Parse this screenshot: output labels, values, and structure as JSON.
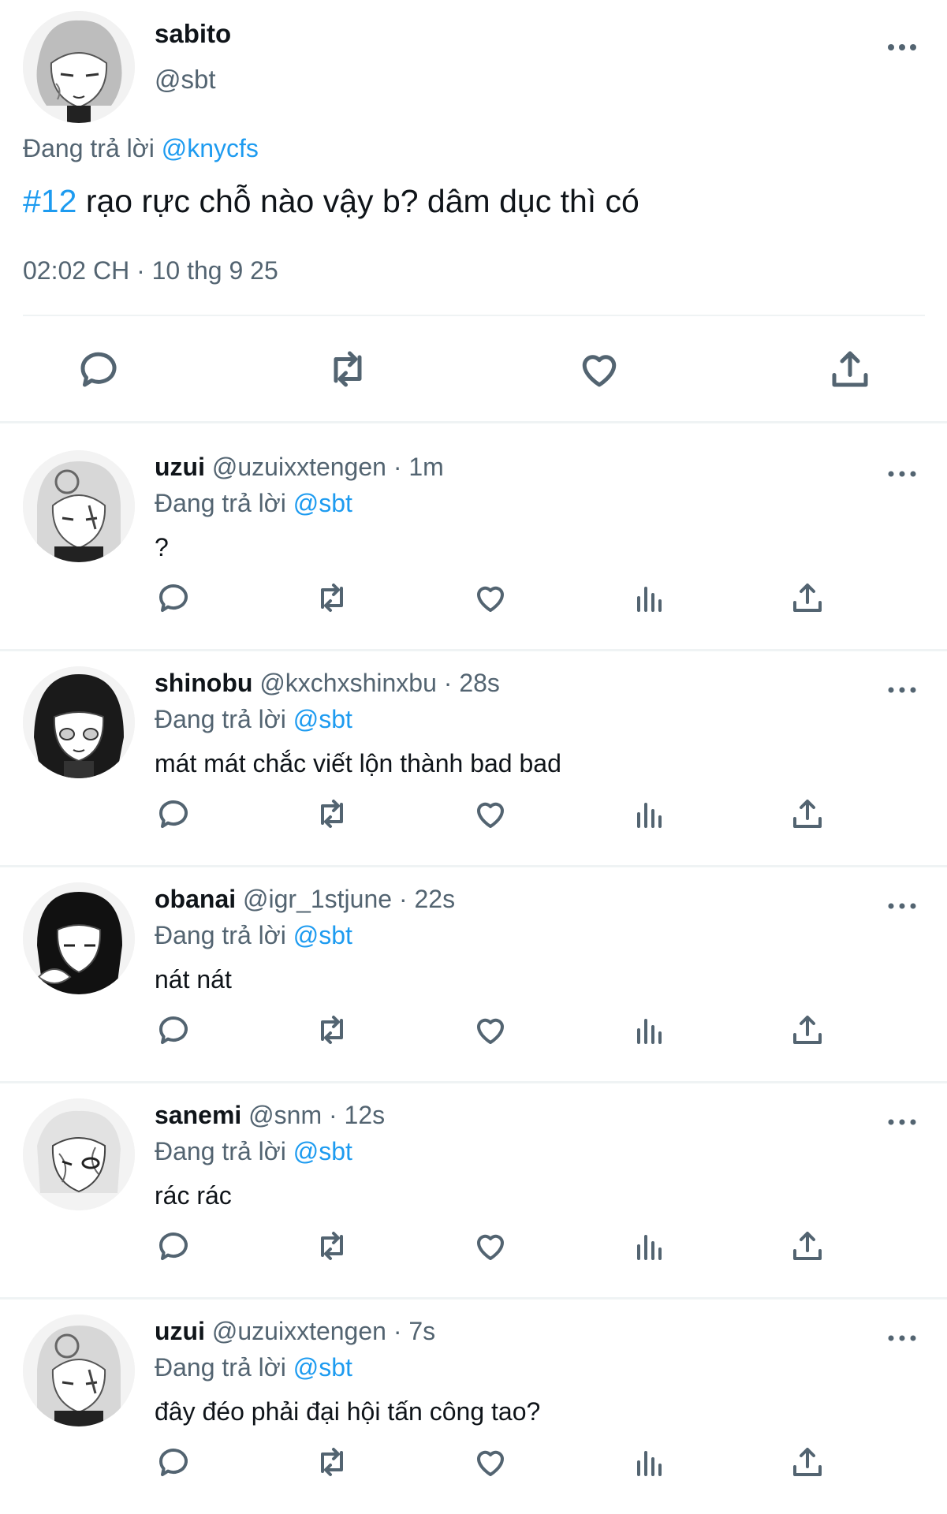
{
  "main_tweet": {
    "display_name": "sabito",
    "handle": "@sbt",
    "replying_label": "Đang trả lời",
    "replying_to": "@knycfs",
    "hashtag": "#12",
    "text": " rạo rực chỗ nào vậy b? dâm dục thì có",
    "timestamp": "02:02 CH · 10 thg 9 25",
    "actions": [
      "reply-icon",
      "retweet-icon",
      "like-icon",
      "share-icon"
    ]
  },
  "replies": [
    {
      "display_name": "uzui",
      "meta": " @uzuixxtengen · 1m",
      "replying_label": "Đang trả lời",
      "replying_to": "@sbt",
      "text": "?"
    },
    {
      "display_name": "shinobu",
      "meta": " @kxchxshinxbu · 28s",
      "replying_label": "Đang trả lời",
      "replying_to": "@sbt",
      "text": "mát mát chắc viết lộn thành bad bad"
    },
    {
      "display_name": "obanai",
      "meta": " @igr_1stjune · 22s",
      "replying_label": "Đang trả lời",
      "replying_to": "@sbt",
      "text": "nát nát"
    },
    {
      "display_name": "sanemi",
      "meta": " @snm · 12s",
      "replying_label": "Đang trả lời",
      "replying_to": "@sbt",
      "text": "rác rác"
    },
    {
      "display_name": "uzui",
      "meta": " @uzuixxtengen · 7s",
      "replying_label": "Đang trả lời",
      "replying_to": "@sbt",
      "text": "đây đéo phải đại hội tấn công tao?"
    }
  ],
  "reply_actions": [
    "reply-icon",
    "retweet-icon",
    "like-icon",
    "views-icon",
    "share-icon"
  ],
  "colors": {
    "link": "#1d9bf0",
    "secondary": "#536471",
    "divider": "#eff3f4"
  }
}
